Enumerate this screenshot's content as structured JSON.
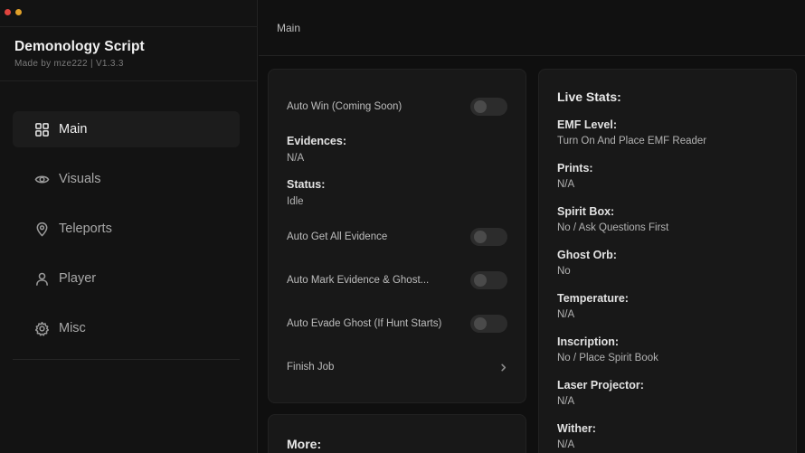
{
  "window": {
    "traffic_colors": [
      "#e0443e",
      "#e0a12a"
    ]
  },
  "sidebar": {
    "title": "Demonology Script",
    "subtitle": "Made by mze222 | V1.3.3",
    "items": [
      {
        "label": "Main",
        "icon": "grid-icon",
        "active": true
      },
      {
        "label": "Visuals",
        "icon": "eye-icon",
        "active": false
      },
      {
        "label": "Teleports",
        "icon": "map-pin-icon",
        "active": false
      },
      {
        "label": "Player",
        "icon": "user-icon",
        "active": false
      },
      {
        "label": "Misc",
        "icon": "gear-icon",
        "active": false
      }
    ]
  },
  "header": {
    "title": "Main"
  },
  "main_panel": {
    "auto_win_label": "Auto Win (Coming Soon)",
    "auto_win_on": false,
    "evidences_label": "Evidences:",
    "evidences_value": "N/A",
    "status_label": "Status:",
    "status_value": "Idle",
    "auto_get_evidence_label": "Auto Get All Evidence",
    "auto_get_evidence_on": false,
    "auto_mark_label": "Auto Mark Evidence & Ghost...",
    "auto_mark_on": false,
    "auto_evade_label": "Auto Evade Ghost (If Hunt Starts)",
    "auto_evade_on": false,
    "finish_job_label": "Finish Job"
  },
  "more_panel": {
    "title": "More:"
  },
  "live_stats": {
    "title": "Live Stats:",
    "stats": [
      {
        "label": "EMF Level:",
        "value": "Turn On And Place EMF Reader"
      },
      {
        "label": "Prints:",
        "value": "N/A"
      },
      {
        "label": "Spirit Box:",
        "value": "No / Ask Questions First"
      },
      {
        "label": "Ghost Orb:",
        "value": "No"
      },
      {
        "label": "Temperature:",
        "value": "N/A"
      },
      {
        "label": "Inscription:",
        "value": "No / Place Spirit Book"
      },
      {
        "label": "Laser Projector:",
        "value": "N/A"
      },
      {
        "label": "Wither:",
        "value": "N/A"
      }
    ]
  }
}
